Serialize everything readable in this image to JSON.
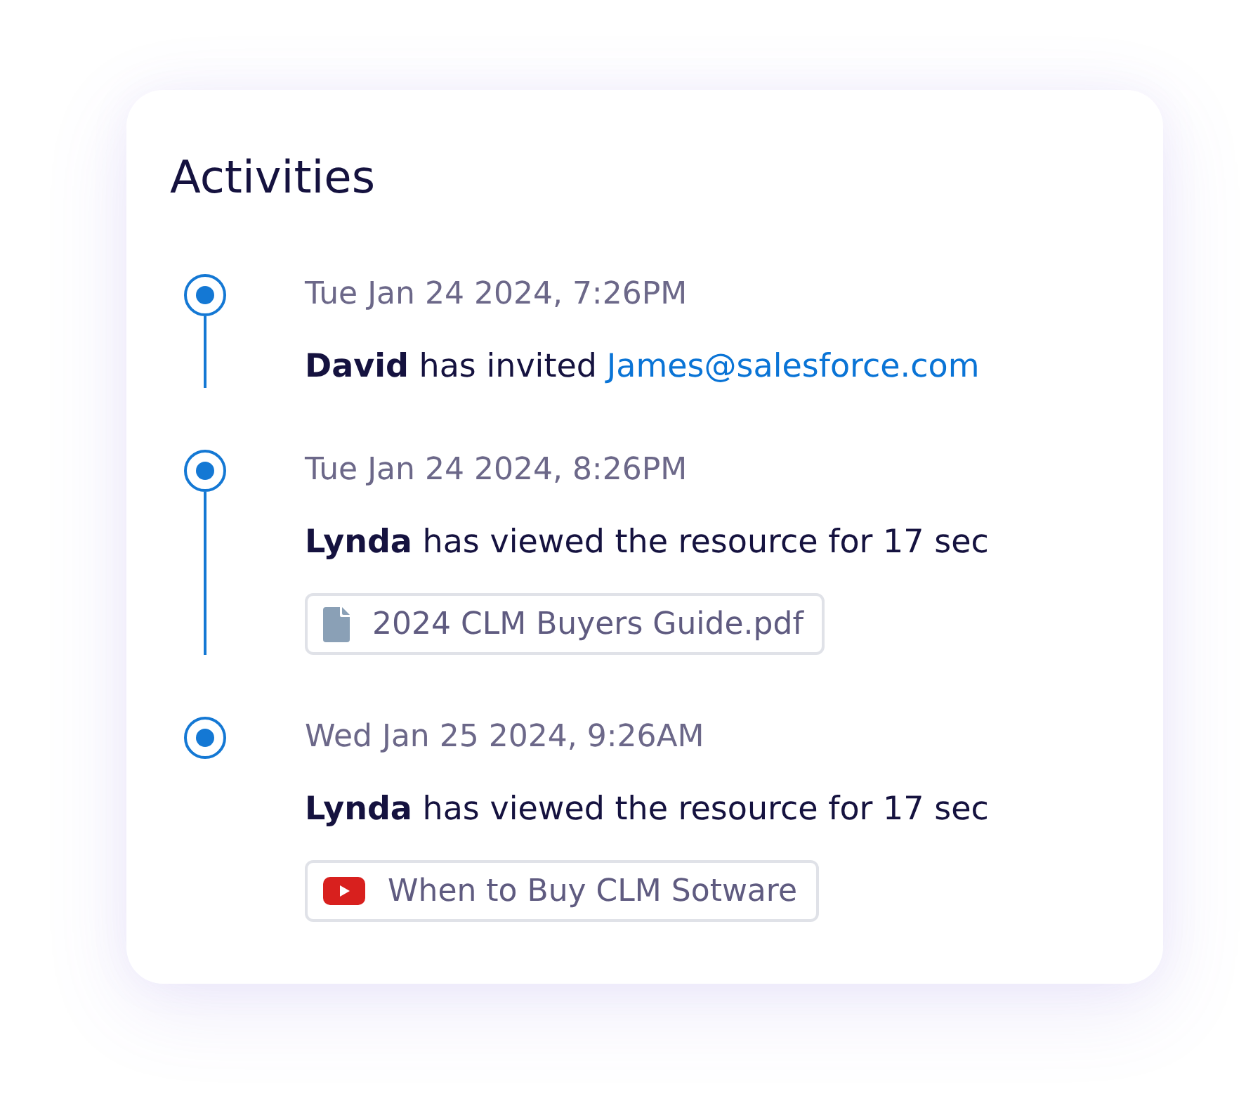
{
  "card": {
    "title": "Activities"
  },
  "activities": [
    {
      "timestamp": "Tue Jan 24 2024, 7:26PM",
      "message": "**David** has invited",
      "link": "James@salesforce.com"
    },
    {
      "timestamp": "Tue Jan 24 2024, 8:26PM",
      "message": "**Lynda** has viewed the resource for 17 sec",
      "attachment": {
        "kind": "pdf",
        "label": "2024 CLM Buyers Guide.pdf"
      }
    },
    {
      "timestamp": "Wed Jan 25 2024, 9:26AM",
      "message": "**Lynda** has viewed the resource for 17 sec",
      "attachment": {
        "kind": "video",
        "label": "When to Buy CLM Sotware"
      }
    }
  ]
}
